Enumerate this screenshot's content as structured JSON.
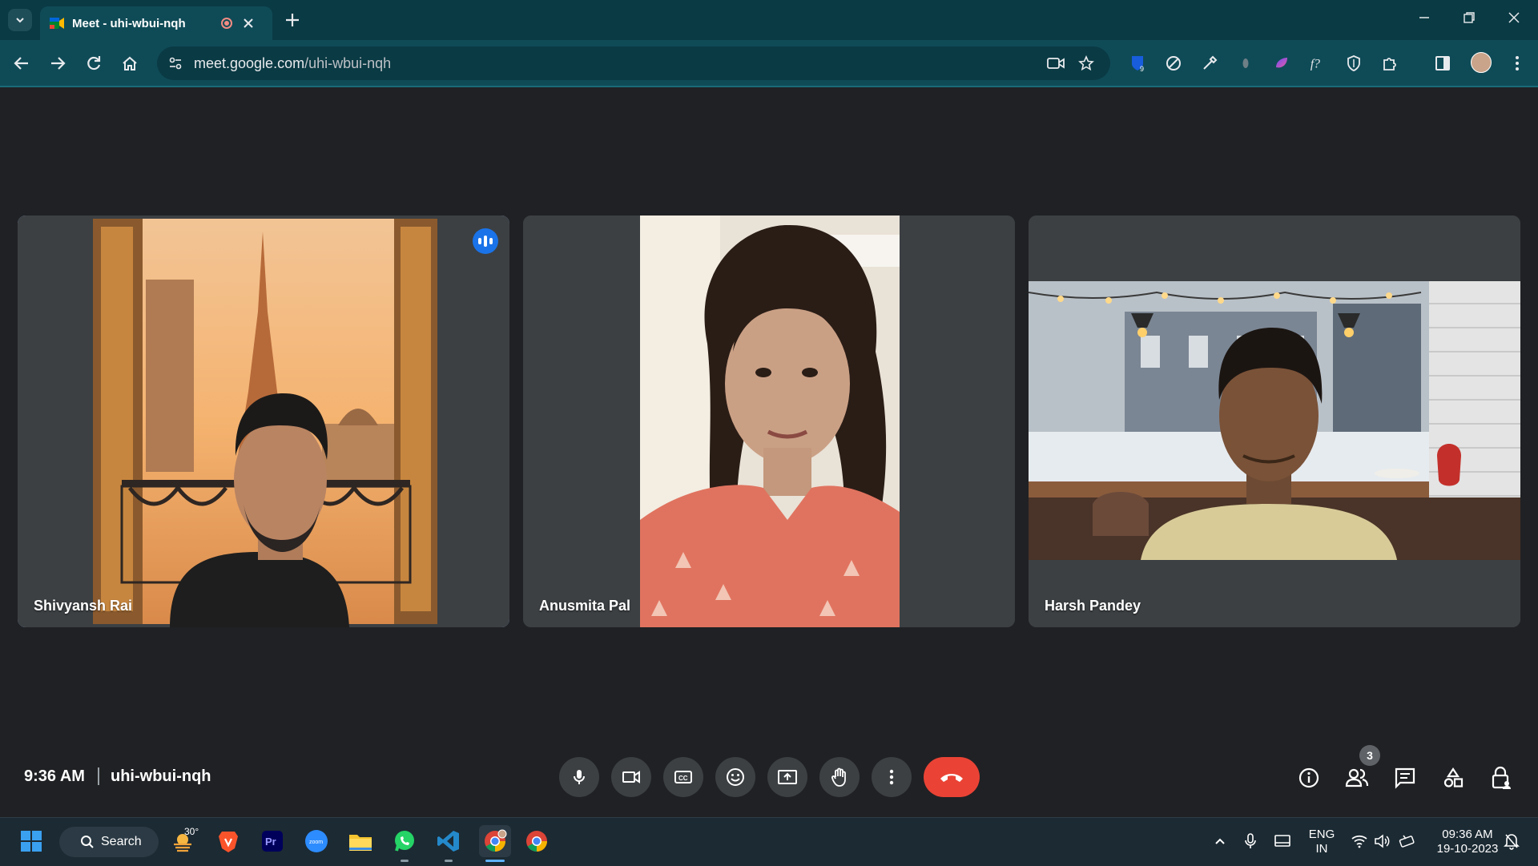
{
  "browser": {
    "tab_title": "Meet - uhi-wbui-nqh",
    "url_host": "meet.google.com",
    "url_path": "/uhi-wbui-nqh",
    "extension_badge": "9"
  },
  "participants": [
    {
      "name": "Shivyansh Rai",
      "speaking": true
    },
    {
      "name": "Anusmita Pal",
      "speaking": false
    },
    {
      "name": "Harsh Pandey",
      "speaking": false
    }
  ],
  "meeting": {
    "time": "9:36 AM",
    "code": "uhi-wbui-nqh",
    "people_count": "3"
  },
  "taskbar": {
    "search_label": "Search",
    "weather_temp": "30°",
    "language_line1": "ENG",
    "language_line2": "IN",
    "clock_time": "09:36 AM",
    "clock_date": "19-10-2023"
  },
  "colors": {
    "browser_frame": "#0a3a44",
    "browser_toolbar": "#0f4b57",
    "meet_background": "#202124",
    "tile_background": "#3c4043",
    "active_speaker_outline": "#8ab4f8",
    "hangup_red": "#ea4335",
    "speaking_indicator": "#1a73e8"
  }
}
